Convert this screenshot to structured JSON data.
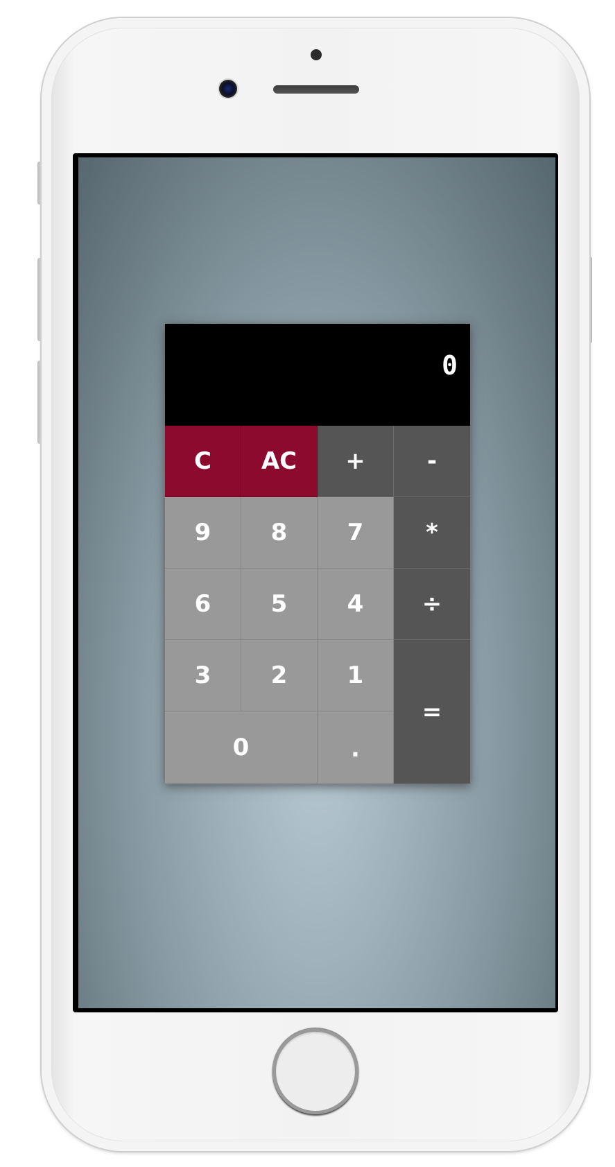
{
  "device": {
    "model": "iPhone",
    "color": "silver-white"
  },
  "calculator": {
    "display_value": "0",
    "colors": {
      "display_bg": "#000000",
      "danger_key": "#8b0a2e",
      "operator_key": "#555555",
      "number_key": "#999999",
      "text": "#ffffff"
    },
    "keys": {
      "clear": "C",
      "all_clear": "AC",
      "plus": "+",
      "minus": "-",
      "multiply": "*",
      "divide": "÷",
      "equals": "=",
      "decimal": ".",
      "seven": "7",
      "eight": "8",
      "nine": "9",
      "four": "4",
      "five": "5",
      "six": "6",
      "one": "1",
      "two": "2",
      "three": "3",
      "zero": "0"
    }
  }
}
